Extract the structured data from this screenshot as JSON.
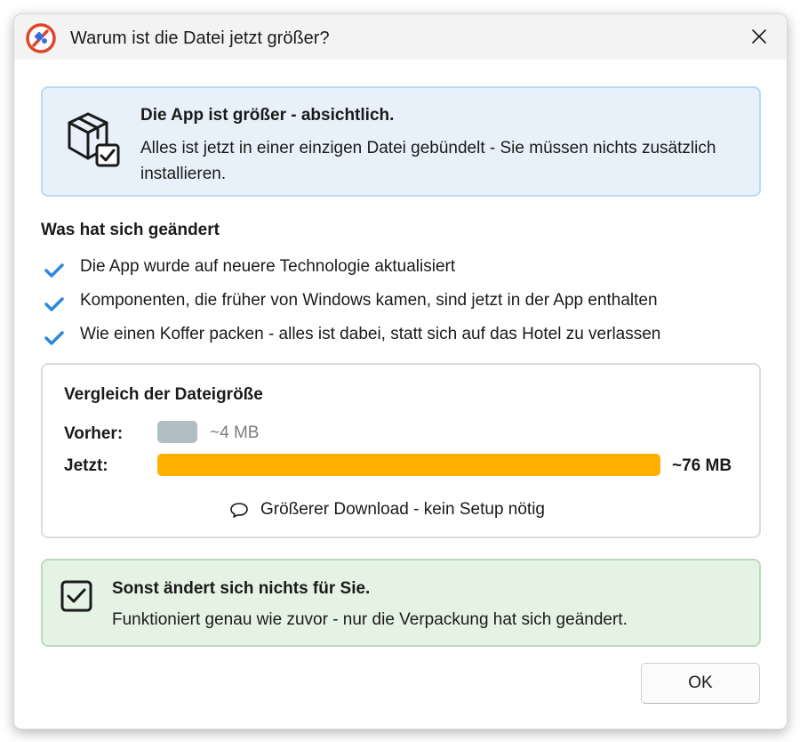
{
  "window": {
    "title": "Warum ist die Datei jetzt größer?",
    "app_icon": "app-logo-icon",
    "close_icon": "close-icon"
  },
  "info": {
    "icon": "package-check-icon",
    "title": "Die App ist größer - absichtlich.",
    "text": "Alles ist jetzt in einer einzigen Datei gebündelt - Sie müssen nichts zusätzlich installieren."
  },
  "changes": {
    "title": "Was hat sich geändert",
    "icon": "checkmark-icon",
    "items": [
      "Die App wurde auf neuere Technologie aktualisiert",
      "Komponenten, die früher von Windows kamen, sind jetzt in der App enthalten",
      "Wie einen Koffer packen - alles ist dabei, statt sich auf das Hotel zu verlassen"
    ]
  },
  "comparison": {
    "title": "Vergleich der Dateigröße",
    "before_label": "Vorher:",
    "before_value": "~4 MB",
    "before_mb": 4,
    "now_label": "Jetzt:",
    "now_value": "~76 MB",
    "now_mb": 76,
    "note_icon": "speech-bubble-icon",
    "note": "Größerer Download - kein Setup nötig"
  },
  "summary": {
    "icon": "checkbox-checked-icon",
    "title": "Sonst ändert sich nichts für Sie.",
    "text": "Funktioniert genau wie zuvor - nur die Verpackung hat sich geändert."
  },
  "buttons": {
    "ok": "OK"
  },
  "colors": {
    "info_bg": "#e8f1fa",
    "info_border": "#b8d9f3",
    "check_blue": "#2b88d8",
    "bar_before": "#b1bec6",
    "bar_now": "#ffb000",
    "success_bg": "#e5f3e5",
    "success_border": "#b9dcb9"
  }
}
